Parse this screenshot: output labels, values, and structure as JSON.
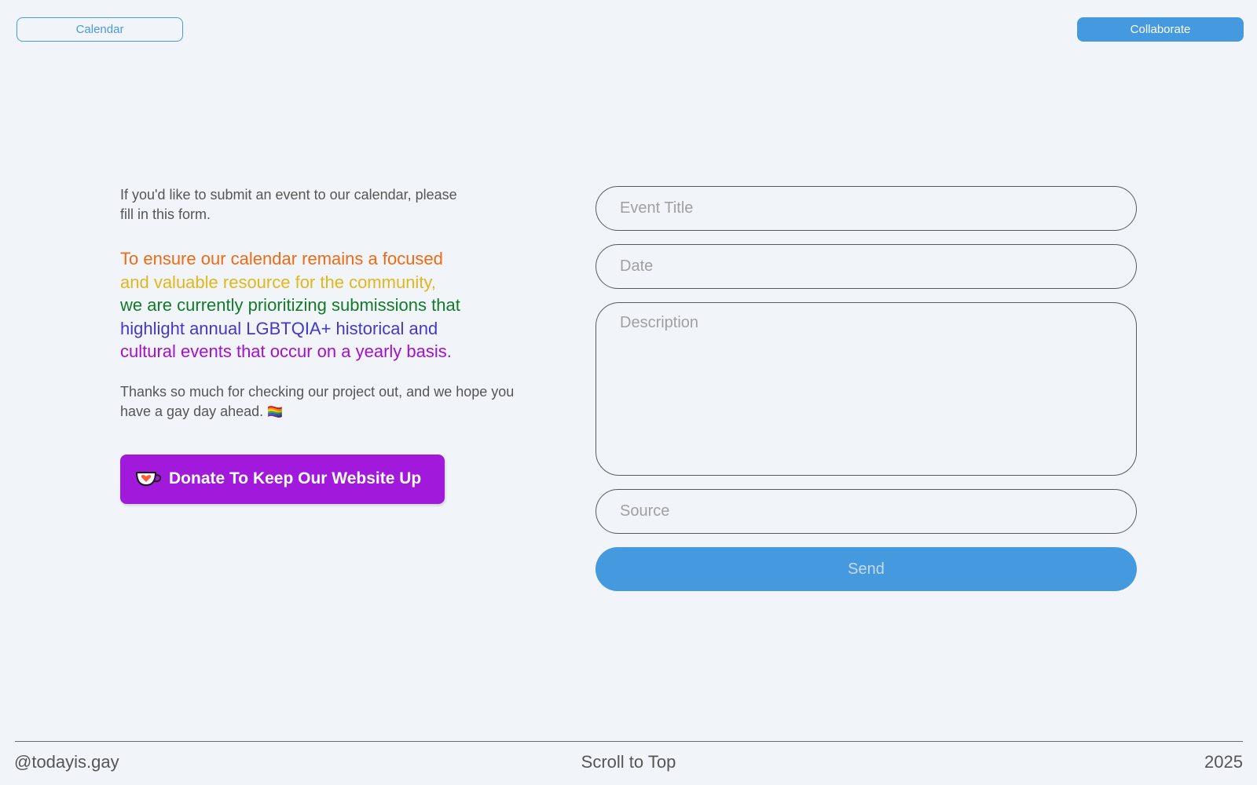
{
  "header": {
    "calendar_label": "Calendar",
    "collaborate_label": "Collaborate"
  },
  "intro": {
    "text": "If you'd like to submit an event to our calendar, please fill in this form."
  },
  "notice": {
    "lines": [
      {
        "text": "To ensure our calendar remains a focused",
        "color": "#f06a14"
      },
      {
        "text": "and valuable resource for the community,",
        "color": "#e3b61b"
      },
      {
        "text": "we are currently prioritizing submissions that",
        "color": "#137a2a"
      },
      {
        "text": "highlight annual LGBTQIA+ historical and",
        "color": "#4438c4"
      },
      {
        "text": "cultural events that occur on a yearly basis.",
        "color": "#a50fcf"
      }
    ]
  },
  "thanks": {
    "text": "Thanks so much for checking our project out, and we hope you have a gay day ahead.",
    "emoji": "🏳️‍🌈"
  },
  "donate": {
    "label": "Donate To Keep Our Website Up",
    "icon": "coffee-cup-heart-icon"
  },
  "form": {
    "title_placeholder": "Event Title",
    "date_placeholder": "Date",
    "description_placeholder": "Description",
    "source_placeholder": "Source",
    "send_label": "Send"
  },
  "footer": {
    "handle": "@todayis.gay",
    "scroll_label": "Scroll to Top",
    "year": "2025"
  },
  "colors": {
    "accent": "#4499df",
    "donate": "#a11adc",
    "background": "#f1f5f9"
  }
}
